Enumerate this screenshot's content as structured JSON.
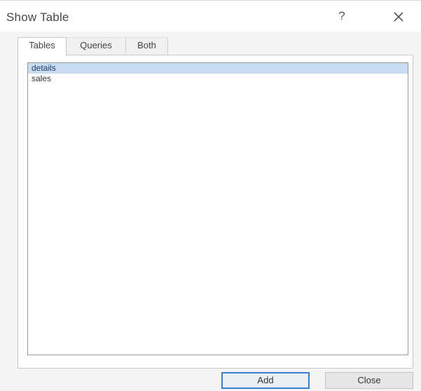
{
  "dialog": {
    "title": "Show Table",
    "help_label": "?",
    "close_icon": "close-icon"
  },
  "tabs": [
    {
      "label": "Tables",
      "active": true
    },
    {
      "label": "Queries",
      "active": false
    },
    {
      "label": "Both",
      "active": false
    }
  ],
  "list": {
    "items": [
      {
        "label": "details",
        "selected": true
      },
      {
        "label": "sales",
        "selected": false
      }
    ]
  },
  "buttons": {
    "add_label": "Add",
    "close_label": "Close"
  },
  "colors": {
    "selection": "#c7dcf0",
    "primary_border": "#3c7fd1"
  }
}
